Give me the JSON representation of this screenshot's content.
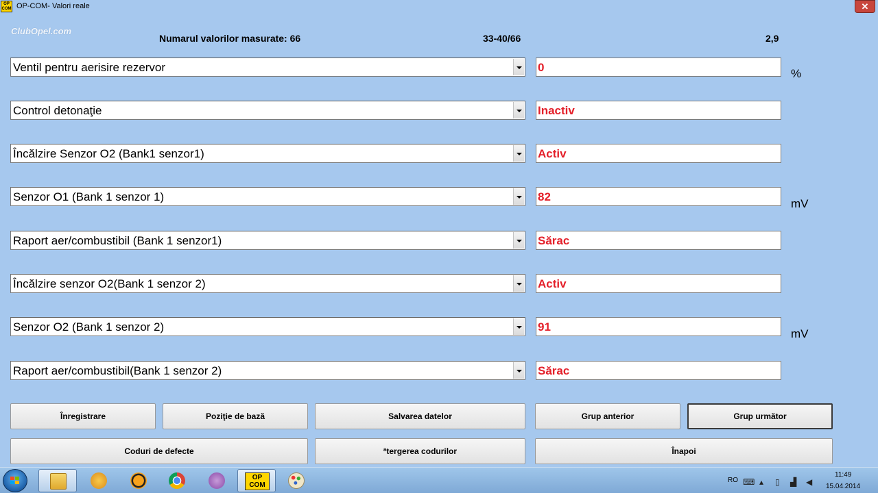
{
  "window": {
    "title": "OP-COM- Valori reale",
    "icon_text": "OP COM",
    "close_label": "✕",
    "watermark": "ClubOpel.com"
  },
  "header": {
    "measured_label": "Numarul valorilor masurate: 66",
    "range": "33-40/66",
    "rate": "2,9"
  },
  "rows": [
    {
      "name": "Ventil pentru aerisire rezervor",
      "value": "0",
      "unit": "%"
    },
    {
      "name": "Control detonaţie",
      "value": "Inactiv",
      "unit": ""
    },
    {
      "name": "Încălzire Senzor O2 (Bank1 senzor1)",
      "value": "Activ",
      "unit": ""
    },
    {
      "name": "Senzor O1 (Bank 1 senzor 1)",
      "value": "82",
      "unit": "mV"
    },
    {
      "name": "Raport aer/combustibil (Bank 1 senzor1)",
      "value": "Sărac",
      "unit": ""
    },
    {
      "name": "Încălzire senzor O2(Bank 1 senzor 2)",
      "value": "Activ",
      "unit": ""
    },
    {
      "name": "Senzor O2 (Bank 1 senzor 2)",
      "value": "91",
      "unit": "mV"
    },
    {
      "name": "Raport aer/combustibil(Bank 1 senzor 2)",
      "value": "Sărac",
      "unit": ""
    }
  ],
  "buttons": {
    "record": "Înregistrare",
    "base_position": "Poziţie de bază",
    "save_data": "Salvarea datelor",
    "prev_group": "Grup anterior",
    "next_group": "Grup următor",
    "fault_codes": "Coduri de defecte",
    "clear_codes": "ªtergerea codurilor",
    "back": "Înapoi"
  },
  "taskbar": {
    "opcom_label": "OP COM",
    "language": "RO",
    "time": "11:49",
    "date": "15.04.2014"
  },
  "colors": {
    "background": "#a6c8ee",
    "value_text": "#e4202a"
  }
}
